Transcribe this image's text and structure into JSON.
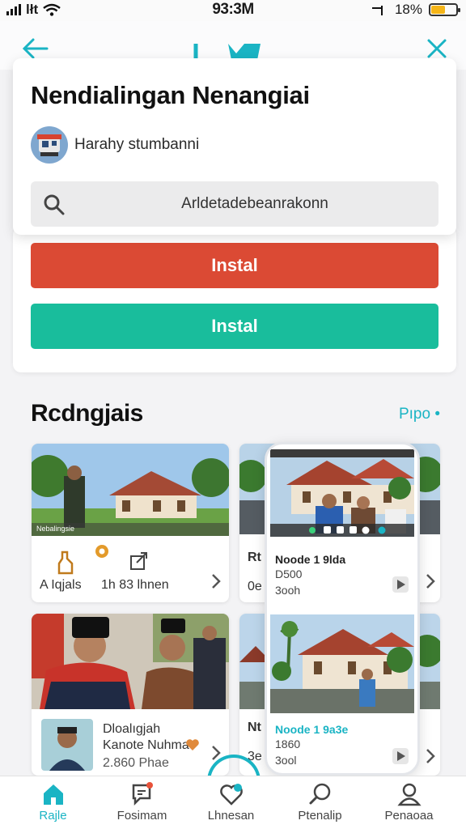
{
  "status_bar": {
    "carrier": "lłt",
    "time": "93:3M",
    "battery": "18%",
    "battery_level": 0.55
  },
  "popup": {
    "title": "Nendialingan Nenangiai",
    "subtitle": "Harahy stumbanni",
    "search_placeholder": "Arldetadebeanrakonn"
  },
  "install": {
    "primary_label": "Instal",
    "secondary_label": "Instal"
  },
  "section": {
    "title": "Rcdngjais",
    "link": "Pıpo •"
  },
  "cards": [
    {
      "image_caption": "Nebalingsie",
      "meta_left": "A Iqjals",
      "meta_mid": "1h 83 lhnen"
    },
    {
      "title_prefix": "Rt",
      "sub_prefix": "0e"
    },
    {
      "title_line1": "Dloalıgjah",
      "title_line2": "Kanote Nuhma",
      "meta": "2.860 Phae"
    },
    {
      "title_prefix": "Nt",
      "sub_prefix": "3e"
    }
  ],
  "phone": {
    "item1": {
      "title": "Noode 1 9lda",
      "sub1": "D500",
      "sub2": "3ooh"
    },
    "item2": {
      "title": "Noode 1 9a3e",
      "sub1": "1860",
      "sub2": "3ool"
    }
  },
  "bottom_nav": [
    {
      "label": "Rajle",
      "icon": "home-icon",
      "active": true
    },
    {
      "label": "Fosimam",
      "icon": "chat-icon",
      "active": false
    },
    {
      "label": "Lhnesan",
      "icon": "heart-icon",
      "active": false
    },
    {
      "label": "Ptenalip",
      "icon": "search-icon",
      "active": false
    },
    {
      "label": "Penaoaa",
      "icon": "profile-icon",
      "active": false
    }
  ],
  "colors": {
    "accent": "#1ab4c4",
    "install_red": "#db4a34",
    "install_green": "#19bd9c",
    "battery": "#f5b518"
  }
}
